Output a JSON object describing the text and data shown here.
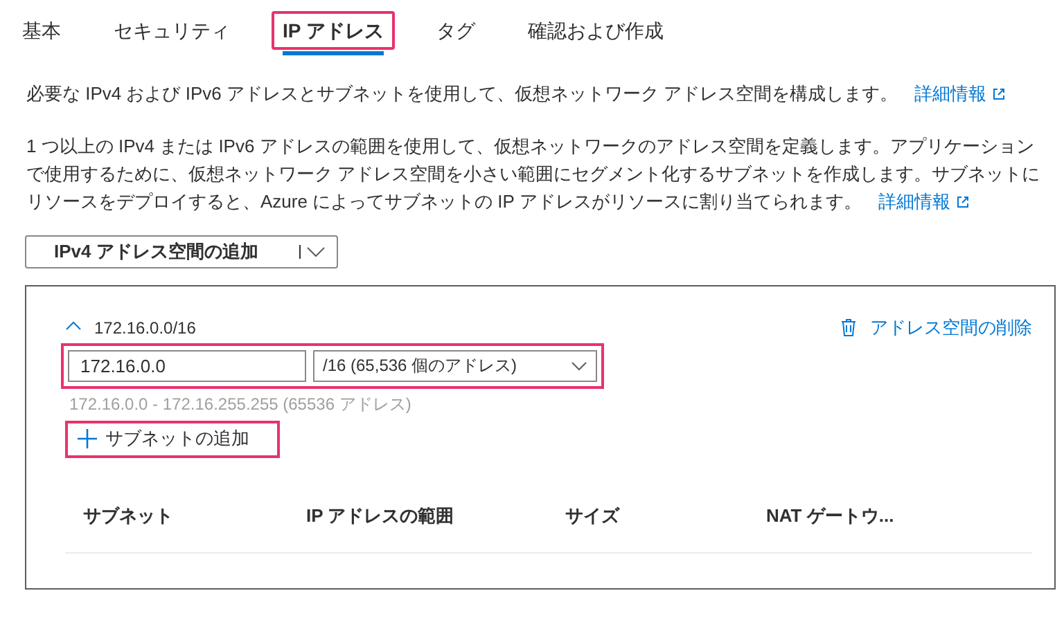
{
  "tabs": [
    {
      "label": "基本",
      "selected": false,
      "highlighted": false
    },
    {
      "label": "セキュリティ",
      "selected": false,
      "highlighted": false
    },
    {
      "label": "IP アドレス",
      "selected": true,
      "highlighted": true
    },
    {
      "label": "タグ",
      "selected": false,
      "highlighted": false
    },
    {
      "label": "確認および作成",
      "selected": false,
      "highlighted": false
    }
  ],
  "intro": {
    "text": "必要な IPv4 および IPv6 アドレスとサブネットを使用して、仮想ネットワーク アドレス空間を構成します。",
    "link": "詳細情報"
  },
  "description": {
    "text": "1 つ以上の IPv4 または IPv6 アドレスの範囲を使用して、仮想ネットワークのアドレス空間を定義します。アプリケーションで使用するために、仮想ネットワーク アドレス空間を小さい範囲にセグメント化するサブネットを作成します。サブネットにリソースをデプロイすると、Azure によってサブネットの IP アドレスがリソースに割り当てられます。",
    "link": "詳細情報"
  },
  "add_space_button": "IPv4 アドレス空間の追加",
  "address_space": {
    "title": "172.16.0.0/16",
    "expanded": true,
    "delete_label": "アドレス空間の削除",
    "fields_highlighted": true,
    "address_value": "172.16.0.0",
    "prefix_value": "/16 (65,536 個のアドレス)",
    "range_hint": "172.16.0.0 - 172.16.255.255 (65536 アドレス)",
    "add_subnet": {
      "label": "サブネットの追加",
      "highlighted": true
    },
    "table": {
      "columns": [
        "サブネット",
        "IP アドレスの範囲",
        "サイズ",
        "NAT ゲートウ..."
      ]
    }
  }
}
